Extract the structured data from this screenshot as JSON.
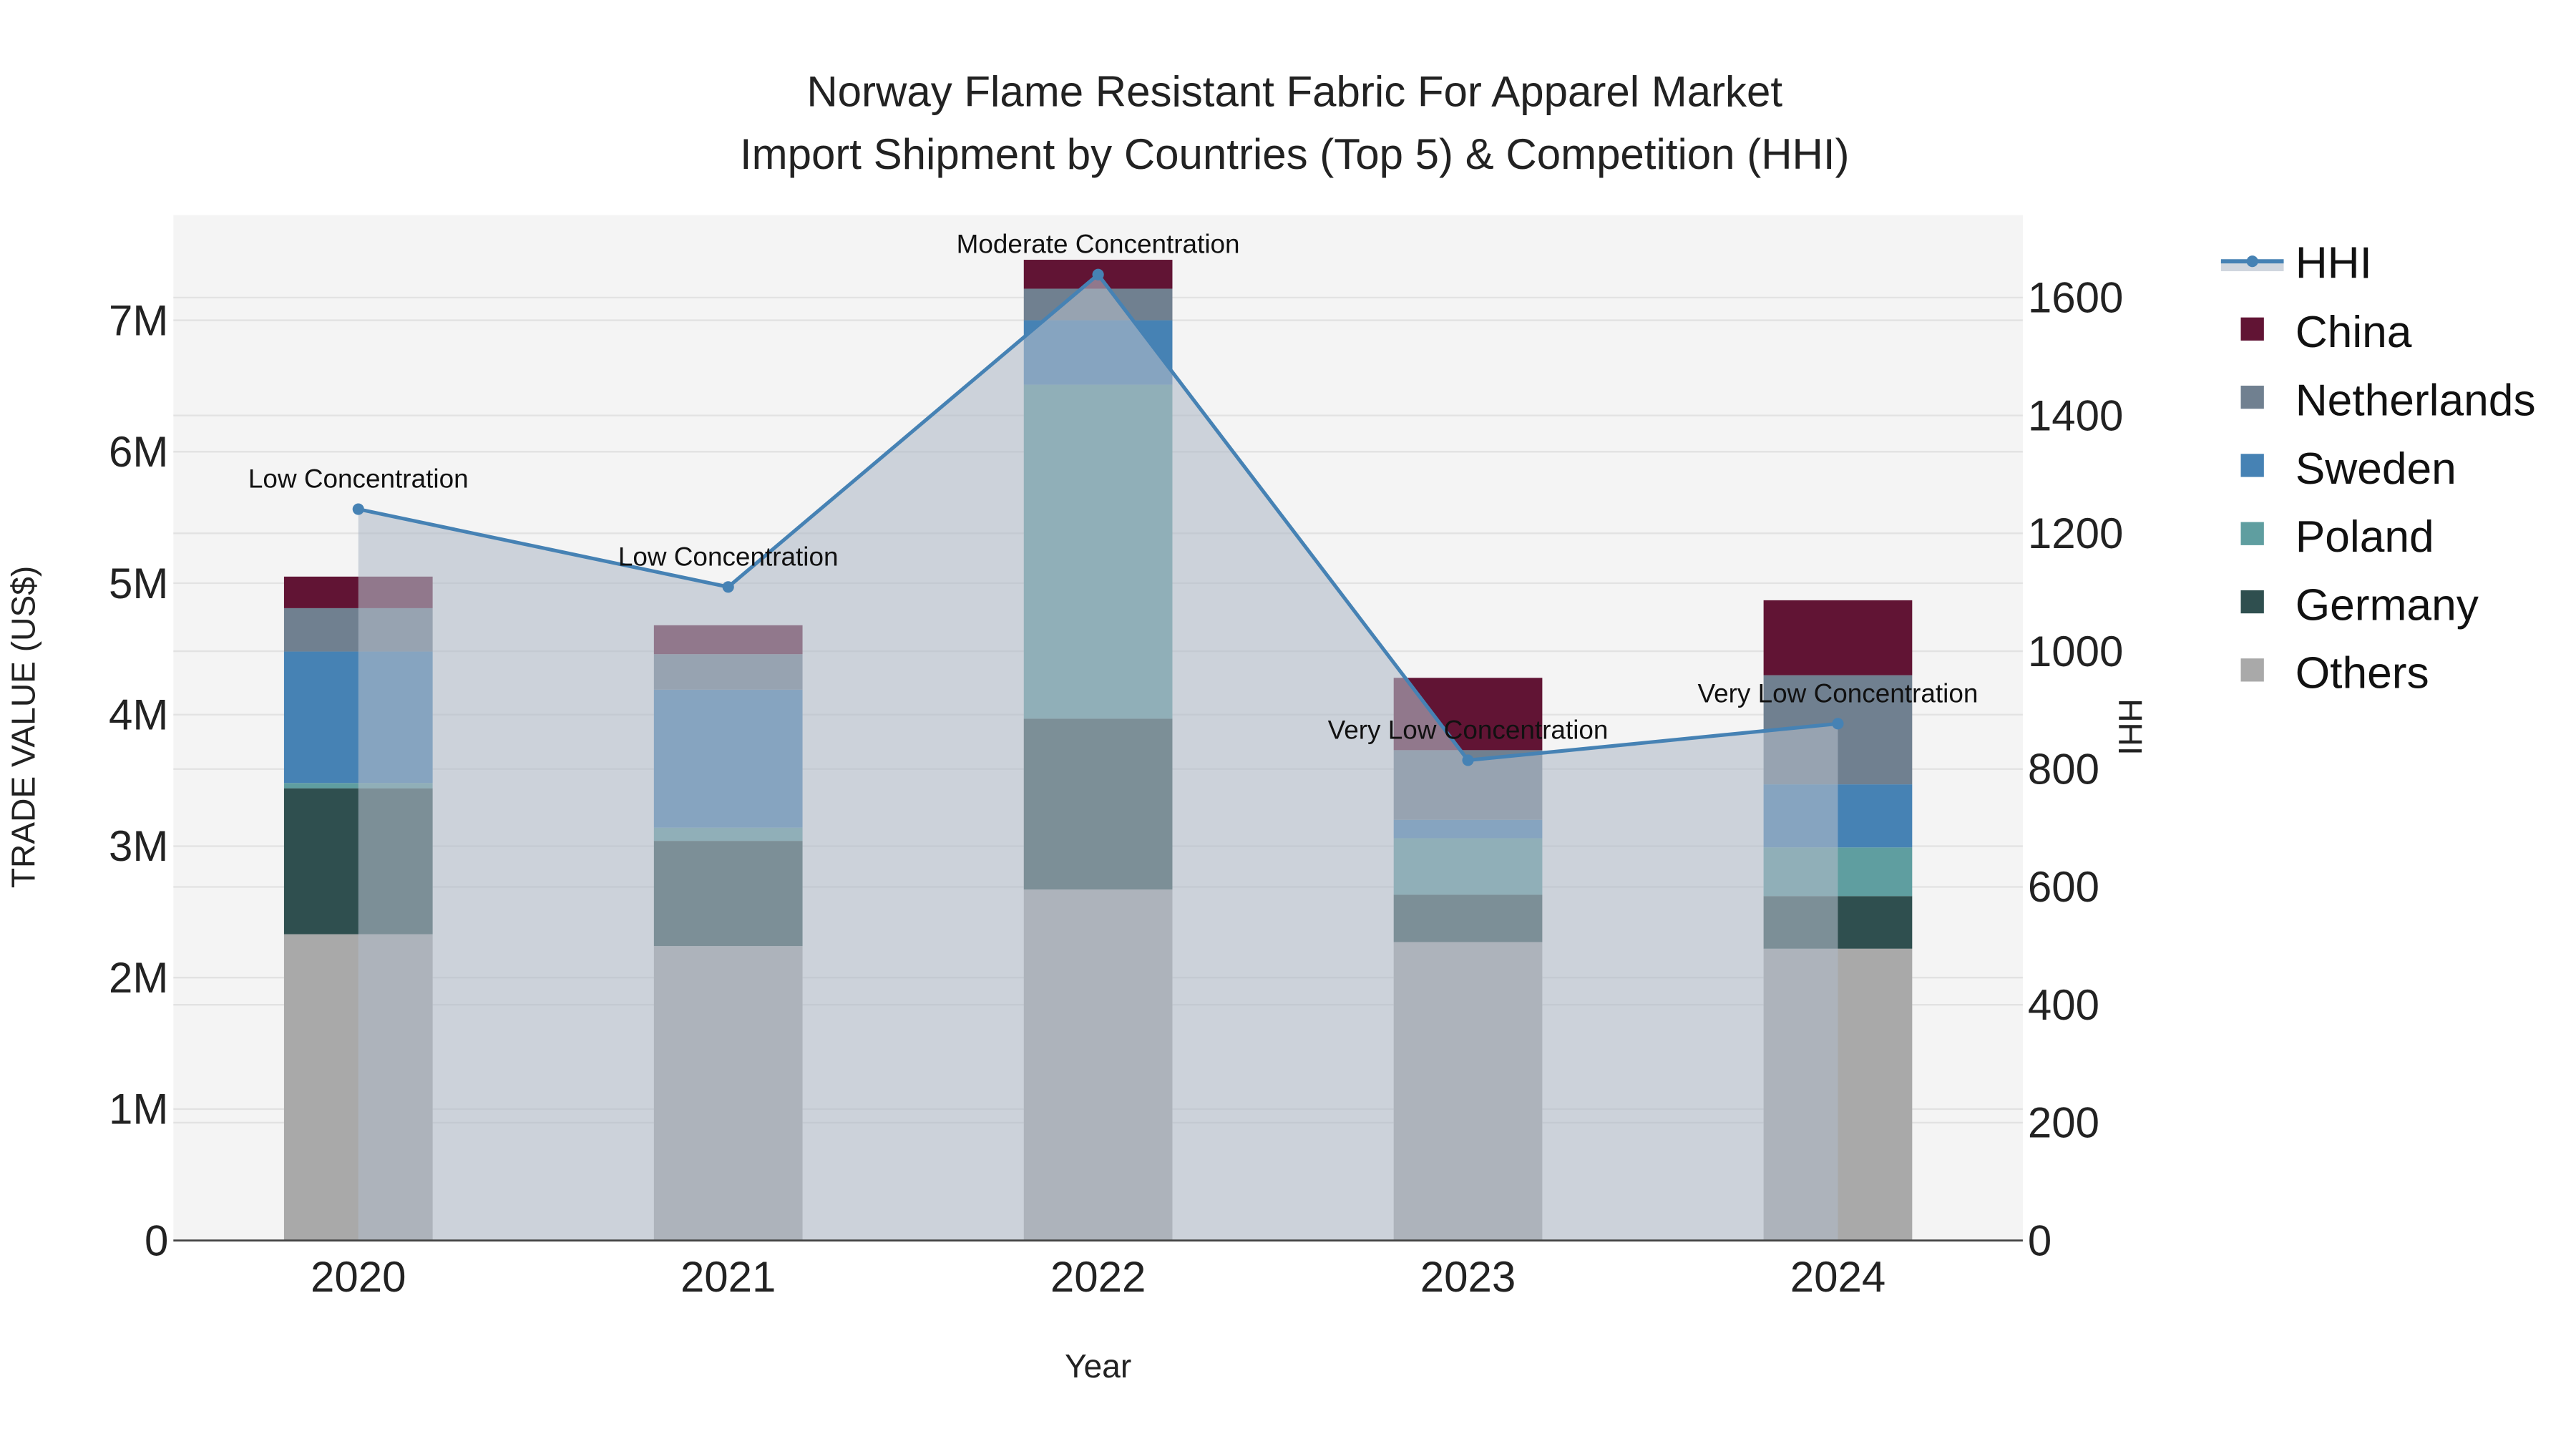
{
  "chart_data": {
    "type": "bar",
    "title_line1": "Norway Flame Resistant Fabric For Apparel Market",
    "title_line2": "Import Shipment by Countries (Top 5) & Competition (HHI)",
    "xlabel": "Year",
    "ylabel": "TRADE VALUE (US$)",
    "y2label": "HHI",
    "categories": [
      "2020",
      "2021",
      "2022",
      "2023",
      "2024"
    ],
    "ylim": [
      0,
      7800000
    ],
    "y2lim": [
      0,
      1740
    ],
    "yticks": [
      0,
      1000000,
      2000000,
      3000000,
      4000000,
      5000000,
      6000000,
      7000000
    ],
    "ytick_labels": [
      "0",
      "1M",
      "2M",
      "3M",
      "4M",
      "5M",
      "6M",
      "7M"
    ],
    "y2ticks": [
      0,
      200,
      400,
      600,
      800,
      1000,
      1200,
      1400,
      1600
    ],
    "y2tick_labels": [
      "0",
      "200",
      "400",
      "600",
      "800",
      "1000",
      "1200",
      "1400",
      "1600"
    ],
    "series": [
      {
        "name": "Others",
        "color": "#A9A9A9",
        "values": [
          2330000,
          2240000,
          2670000,
          2270000,
          2220000
        ]
      },
      {
        "name": "Germany",
        "color": "#2F4F4F",
        "values": [
          1110000,
          800000,
          1300000,
          360000,
          400000
        ]
      },
      {
        "name": "Poland",
        "color": "#5F9EA0",
        "values": [
          40000,
          100000,
          2540000,
          430000,
          370000
        ]
      },
      {
        "name": "Sweden",
        "color": "#4682B4",
        "values": [
          1000000,
          1050000,
          490000,
          140000,
          480000
        ]
      },
      {
        "name": "Netherlands",
        "color": "#708090",
        "values": [
          330000,
          270000,
          240000,
          530000,
          830000
        ]
      },
      {
        "name": "China",
        "color": "#611434",
        "values": [
          240000,
          220000,
          220000,
          550000,
          570000
        ]
      }
    ],
    "hhi": {
      "name": "HHI",
      "color": "#4682B4",
      "values": [
        1241,
        1109,
        1639,
        815,
        877
      ],
      "annotations": [
        "Low Concentration",
        "Low Concentration",
        "Moderate Concentration",
        "Very Low Concentration",
        "Very Low Concentration"
      ]
    },
    "legend": [
      "HHI",
      "China",
      "Netherlands",
      "Sweden",
      "Poland",
      "Germany",
      "Others"
    ],
    "legend_position": "right",
    "grid": true
  }
}
